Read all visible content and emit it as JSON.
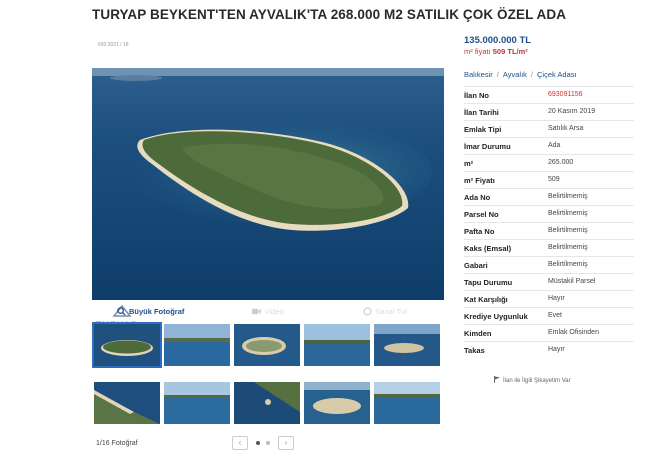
{
  "listing": {
    "title": "TURYAP BEYKENT'TEN AYVALIK'TA 268.000 M2 SATILIK ÇOK ÖZEL ADA",
    "photo_caption": "693 2021 / 18"
  },
  "gallery": {
    "logo_text": "TURYAP",
    "tabs": [
      {
        "label": "Büyük Fotoğraf",
        "icon": "search-icon"
      },
      {
        "label": "Video",
        "icon": "video-icon"
      },
      {
        "label": "Sanal Tur",
        "icon": "pano-icon"
      }
    ],
    "photo_count": "1/16 Fotoğraf",
    "prev_label": "‹",
    "next_label": "›",
    "pages": 2,
    "current_page": 1
  },
  "price": {
    "amount": "135.000.000 TL",
    "m2_prefix": "m² fiyatı",
    "m2_value": "509 TL/m²"
  },
  "breadcrumb": [
    "Balıkesir",
    "Ayvalık",
    "Çiçek Adası"
  ],
  "details": [
    {
      "key": "İlan No",
      "value": "693091156",
      "highlight": true
    },
    {
      "key": "İlan Tarihi",
      "value": "20 Kasım 2019"
    },
    {
      "key": "Emlak Tipi",
      "value": "Satılık Arsa"
    },
    {
      "key": "İmar Durumu",
      "value": "Ada"
    },
    {
      "key": "m²",
      "value": "265.000"
    },
    {
      "key": "m² Fiyatı",
      "value": "509"
    },
    {
      "key": "Ada No",
      "value": "Belirtilmemiş"
    },
    {
      "key": "Parsel No",
      "value": "Belirtilmemiş"
    },
    {
      "key": "Pafta No",
      "value": "Belirtilmemiş"
    },
    {
      "key": "Kaks (Emsal)",
      "value": "Belirtilmemiş"
    },
    {
      "key": "Gabari",
      "value": "Belirtilmemiş"
    },
    {
      "key": "Tapu Durumu",
      "value": "Müstakil Parsel"
    },
    {
      "key": "Kat Karşılığı",
      "value": "Hayır"
    },
    {
      "key": "Krediye Uygunluk",
      "value": "Evet"
    },
    {
      "key": "Kimden",
      "value": "Emlak Ofisinden"
    },
    {
      "key": "Takas",
      "value": "Hayır"
    }
  ],
  "complaint": {
    "label": "İlan ile İlgili Şikayetim Var",
    "icon": "flag-icon"
  },
  "colors": {
    "link": "#1e4f8c",
    "highlight": "#d0312d",
    "sea": "#1b4a78"
  }
}
